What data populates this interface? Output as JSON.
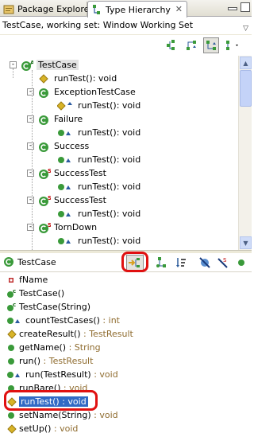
{
  "tabs": [
    {
      "label": "Package Explorer",
      "icon": "package-explorer-icon",
      "active": false
    },
    {
      "label": "Type Hierarchy",
      "icon": "type-hierarchy-icon",
      "active": true
    }
  ],
  "content_description": "TestCase, working set: Window Working Set",
  "tree": [
    {
      "label": "TestCase",
      "kind": "class-abstract",
      "level": 0,
      "expander": "-",
      "selected": true
    },
    {
      "label": "runTest()",
      "ret": " : void",
      "kind": "method-protected",
      "level": 1
    },
    {
      "label": "ExceptionTestCase",
      "kind": "class",
      "level": 1,
      "expander": "-"
    },
    {
      "label": "runTest()",
      "ret": " : void",
      "kind": "method-override-protected",
      "level": 2
    },
    {
      "label": "Failure",
      "kind": "class",
      "level": 1,
      "expander": "-"
    },
    {
      "label": "runTest()",
      "ret": " : void",
      "kind": "method-override",
      "level": 2
    },
    {
      "label": "Success",
      "kind": "class",
      "level": 1,
      "expander": "-"
    },
    {
      "label": "runTest()",
      "ret": " : void",
      "kind": "method-override",
      "level": 2
    },
    {
      "label": "SuccessTest",
      "kind": "class-static",
      "level": 1,
      "expander": "-"
    },
    {
      "label": "runTest()",
      "ret": " : void",
      "kind": "method-override",
      "level": 2
    },
    {
      "label": "SuccessTest",
      "kind": "class-static",
      "level": 1,
      "expander": "-"
    },
    {
      "label": "runTest()",
      "ret": " : void",
      "kind": "method-override",
      "level": 2
    },
    {
      "label": "TornDown",
      "kind": "class-static",
      "level": 1,
      "expander": "-"
    },
    {
      "label": "runTest()",
      "ret": " : void",
      "kind": "method-override",
      "level": 2
    }
  ],
  "members_title": "TestCase",
  "members": [
    {
      "label": "fName",
      "ret": "",
      "kind": "field-private"
    },
    {
      "label": "TestCase()",
      "ret": "",
      "kind": "constructor"
    },
    {
      "label": "TestCase(String)",
      "ret": "",
      "kind": "constructor"
    },
    {
      "label": "countTestCases()",
      "ret": " : int",
      "kind": "method-override"
    },
    {
      "label": "createResult()",
      "ret": " : TestResult",
      "kind": "method-protected"
    },
    {
      "label": "getName()",
      "ret": " : String",
      "kind": "method"
    },
    {
      "label": "run()",
      "ret": " : TestResult",
      "kind": "method"
    },
    {
      "label": "run(TestResult)",
      "ret": " : void",
      "kind": "method-override"
    },
    {
      "label": "runBare()",
      "ret": " : void",
      "kind": "method"
    },
    {
      "label": "runTest()",
      "ret": " : void",
      "kind": "method-protected",
      "selected": true
    },
    {
      "label": "setName(String)",
      "ret": " : void",
      "kind": "method"
    },
    {
      "label": "setUp()",
      "ret": " : void",
      "kind": "method-protected"
    }
  ],
  "colors": {
    "selection": "#316ac5",
    "highlight_ring": "#e01010",
    "return_type": "#8f6c2f",
    "public_method": "#3a9a3a",
    "protected_method": "#d8b428",
    "private_field": "#c03030"
  }
}
